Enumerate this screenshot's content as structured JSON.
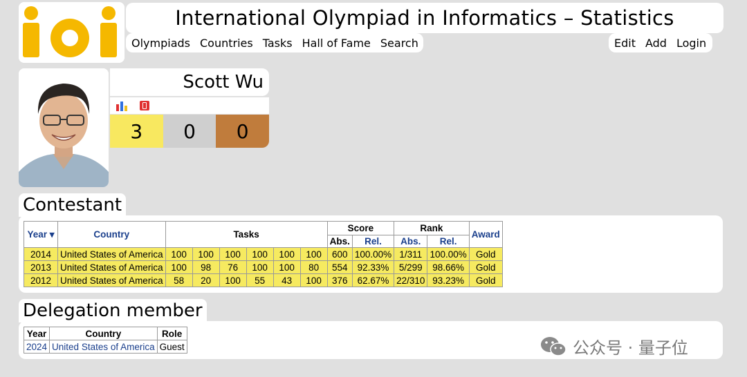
{
  "header": {
    "logo_text": "ioi",
    "title": "International Olympiad in Informatics – Statistics",
    "nav_left": [
      "Olympiads",
      "Countries",
      "Tasks",
      "Hall of Fame",
      "Search"
    ],
    "nav_right": [
      "Edit",
      "Add",
      "Login"
    ]
  },
  "profile": {
    "name": "Scott Wu",
    "icons": [
      "bar-chart-icon",
      "red-card-icon"
    ],
    "medals": {
      "gold": "3",
      "silver": "0",
      "bronze": "0"
    }
  },
  "contestant": {
    "heading": "Contestant",
    "headers": {
      "year": "Year ▾",
      "country": "Country",
      "tasks": "Tasks",
      "score": "Score",
      "rank": "Rank",
      "award": "Award",
      "abs": "Abs.",
      "rel": "Rel."
    },
    "rows": [
      {
        "year": "2014",
        "country": "United States of America",
        "tasks": [
          "100",
          "100",
          "100",
          "100",
          "100",
          "100"
        ],
        "score_abs": "600",
        "score_rel": "100.00%",
        "rank_abs": "1/311",
        "rank_rel": "100.00%",
        "award": "Gold"
      },
      {
        "year": "2013",
        "country": "United States of America",
        "tasks": [
          "100",
          "98",
          "76",
          "100",
          "100",
          "80"
        ],
        "score_abs": "554",
        "score_rel": "92.33%",
        "rank_abs": "5/299",
        "rank_rel": "98.66%",
        "award": "Gold"
      },
      {
        "year": "2012",
        "country": "United States of America",
        "tasks": [
          "58",
          "20",
          "100",
          "55",
          "43",
          "100"
        ],
        "score_abs": "376",
        "score_rel": "62.67%",
        "rank_abs": "22/310",
        "rank_rel": "93.23%",
        "award": "Gold"
      }
    ]
  },
  "delegation": {
    "heading": "Delegation member",
    "headers": {
      "year": "Year",
      "country": "Country",
      "role": "Role"
    },
    "rows": [
      {
        "year": "2024",
        "country": "United States of America",
        "role": "Guest"
      }
    ]
  },
  "watermark": {
    "text": "公众号 · 量子位",
    "icon": "wechat-icon"
  },
  "colors": {
    "gold": "#f8e860",
    "silver": "#cfcfcf",
    "bronze": "#c07c3c",
    "link": "#1a3f8c",
    "logo": "#f5b800"
  }
}
